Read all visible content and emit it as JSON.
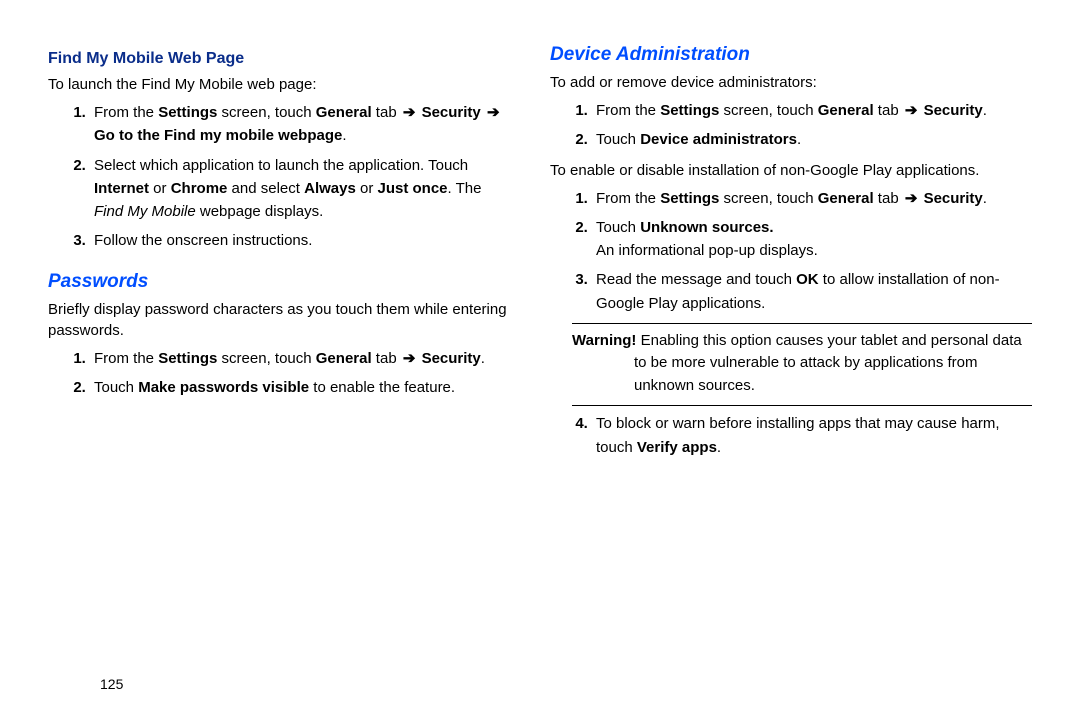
{
  "page_number": "125",
  "left": {
    "heading1": "Find My Mobile Web Page",
    "intro1": "To launch the Find My Mobile web page:",
    "li1_a": "From the ",
    "li1_b": "Settings",
    "li1_c": " screen, touch ",
    "li1_d": "General",
    "li1_e": " tab ",
    "li1_f": "Security",
    "li1_g": "Go to the Find my mobile webpage",
    "li2_a": "Select which application to launch the application. Touch ",
    "li2_b": "Internet",
    "li2_c": " or ",
    "li2_d": "Chrome",
    "li2_e": " and select ",
    "li2_f": "Always",
    "li2_g": " or ",
    "li2_h": "Just once",
    "li2_i": ". The ",
    "li2_j": "Find My Mobile",
    "li2_k": " webpage displays.",
    "li3": "Follow the onscreen instructions.",
    "heading2": "Passwords",
    "intro2": "Briefly display password characters as you touch them while entering passwords.",
    "pw_li1_a": "From the ",
    "pw_li1_b": "Settings",
    "pw_li1_c": " screen, touch ",
    "pw_li1_d": "General",
    "pw_li1_e": " tab ",
    "pw_li1_f": "Security",
    "pw_li2_a": "Touch ",
    "pw_li2_b": "Make passwords visible",
    "pw_li2_c": " to enable the feature."
  },
  "right": {
    "heading": "Device Administration",
    "intro": "To add or remove device administrators:",
    "a_li1_a": "From the ",
    "a_li1_b": "Settings",
    "a_li1_c": " screen, touch ",
    "a_li1_d": "General",
    "a_li1_e": " tab ",
    "a_li1_f": "Security",
    "a_li2_a": "Touch ",
    "a_li2_b": "Device administrators",
    "intro2": "To enable or disable installation of non-Google Play applications.",
    "b_li1_a": "From the ",
    "b_li1_b": "Settings",
    "b_li1_c": " screen, touch ",
    "b_li1_d": "General",
    "b_li1_e": " tab ",
    "b_li1_f": "Security",
    "b_li2_a": "Touch ",
    "b_li2_b": "Unknown sources.",
    "b_li2_c": "An informational pop-up displays.",
    "b_li3_a": "Read the message and touch ",
    "b_li3_b": "OK",
    "b_li3_c": " to allow installation of non-Google Play applications.",
    "warn_label": "Warning!",
    "warn_text": " Enabling this option causes your tablet and personal data to be more vulnerable to attack by applications from unknown sources.",
    "b_li4_a": "To block or warn before installing apps that may cause harm, touch ",
    "b_li4_b": "Verify apps",
    "b_li4_c": "."
  },
  "arrow": "➔"
}
